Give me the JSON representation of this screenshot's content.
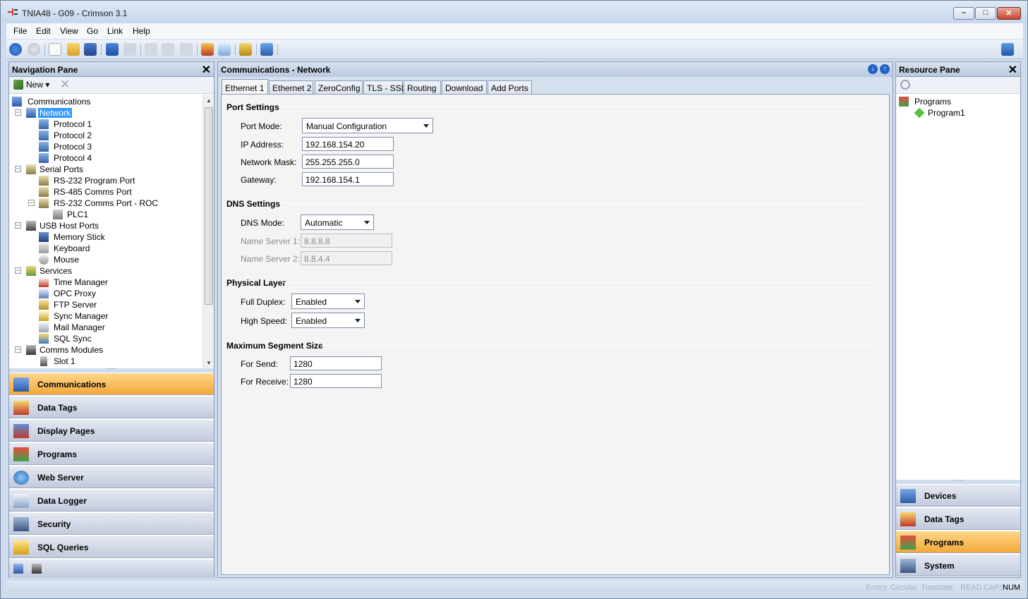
{
  "window": {
    "title": "TNIA48 - G09 - Crimson 3.1",
    "min_glyph": "–",
    "max_glyph": "□",
    "close_glyph": "✕"
  },
  "menu": [
    "File",
    "Edit",
    "View",
    "Go",
    "Link",
    "Help"
  ],
  "nav_pane": {
    "title": "Navigation Pane",
    "close": "✕",
    "new_label": "New",
    "tree": [
      {
        "label": "Communications",
        "icon": "communications-icon"
      },
      {
        "label": "Network",
        "icon": "network-icon",
        "selected": true
      },
      {
        "label": "Protocol 1",
        "icon": "protocol-icon"
      },
      {
        "label": "Protocol 2",
        "icon": "protocol-icon"
      },
      {
        "label": "Protocol 3",
        "icon": "protocol-icon"
      },
      {
        "label": "Protocol 4",
        "icon": "protocol-icon"
      },
      {
        "label": "Serial Ports",
        "icon": "serial-port-icon"
      },
      {
        "label": "RS-232 Program Port",
        "icon": "serial-port-icon"
      },
      {
        "label": "RS-485 Comms Port",
        "icon": "serial-port-icon"
      },
      {
        "label": "RS-232 Comms Port - ROC",
        "icon": "serial-port-icon"
      },
      {
        "label": "PLC1",
        "icon": "plc-icon"
      },
      {
        "label": "USB Host Ports",
        "icon": "usb-icon"
      },
      {
        "label": "Memory Stick",
        "icon": "memory-stick-icon"
      },
      {
        "label": "Keyboard",
        "icon": "keyboard-icon"
      },
      {
        "label": "Mouse",
        "icon": "mouse-icon"
      },
      {
        "label": "Services",
        "icon": "services-icon"
      },
      {
        "label": "Time Manager",
        "icon": "time-manager-icon"
      },
      {
        "label": "OPC Proxy",
        "icon": "opc-proxy-icon"
      },
      {
        "label": "FTP Server",
        "icon": "ftp-server-icon"
      },
      {
        "label": "Sync Manager",
        "icon": "sync-manager-icon"
      },
      {
        "label": "Mail Manager",
        "icon": "mail-manager-icon"
      },
      {
        "label": "SQL Sync",
        "icon": "sql-sync-icon"
      },
      {
        "label": "Comms Modules",
        "icon": "comms-modules-icon"
      },
      {
        "label": "Slot 1",
        "icon": "slot-icon"
      }
    ],
    "categories": [
      {
        "label": "Communications",
        "active": true
      },
      {
        "label": "Data Tags"
      },
      {
        "label": "Display Pages"
      },
      {
        "label": "Programs"
      },
      {
        "label": "Web Server"
      },
      {
        "label": "Data Logger"
      },
      {
        "label": "Security"
      },
      {
        "label": "SQL Queries"
      }
    ]
  },
  "main": {
    "title": "Communications - Network",
    "tabs": [
      "Ethernet 1",
      "Ethernet 2",
      "ZeroConfig",
      "TLS - SSL",
      "Routing",
      "Download",
      "Add Ports"
    ],
    "active_tab": "Ethernet 1",
    "port_settings": {
      "heading": "Port Settings",
      "port_mode_label": "Port Mode:",
      "port_mode": "Manual Configuration",
      "ip_label": "IP Address:",
      "ip": "192.168.154.20",
      "mask_label": "Network Mask:",
      "mask": "255.255.255.0",
      "gateway_label": "Gateway:",
      "gateway": "192.168.154.1"
    },
    "dns_settings": {
      "heading": "DNS Settings",
      "mode_label": "DNS Mode:",
      "mode": "Automatic",
      "ns1_label": "Name Server 1:",
      "ns1": "8.8.8.8",
      "ns2_label": "Name Server 2:",
      "ns2": "8.8.4.4"
    },
    "physical_layer": {
      "heading": "Physical Layer",
      "duplex_label": "Full Duplex:",
      "duplex": "Enabled",
      "speed_label": "High Speed:",
      "speed": "Enabled"
    },
    "mss": {
      "heading": "Maximum Segment Size",
      "send_label": "For Send:",
      "send": "1280",
      "receive_label": "For Receive:",
      "receive": "1280"
    }
  },
  "resource_pane": {
    "title": "Resource Pane",
    "close": "✕",
    "tree": [
      {
        "label": "Programs",
        "icon": "programs-icon"
      },
      {
        "label": "Program1",
        "icon": "program-diamond-icon"
      }
    ],
    "categories": [
      {
        "label": "Devices"
      },
      {
        "label": "Data Tags"
      },
      {
        "label": "Programs",
        "active": true
      },
      {
        "label": "System"
      }
    ]
  },
  "status": {
    "items": [
      {
        "label": "Errors",
        "on": false
      },
      {
        "label": "Circular",
        "on": false
      },
      {
        "label": "Translate",
        "on": false
      },
      {
        "label": "READ",
        "on": false
      },
      {
        "label": "CAPS",
        "on": false
      },
      {
        "label": "NUM",
        "on": true
      }
    ]
  }
}
